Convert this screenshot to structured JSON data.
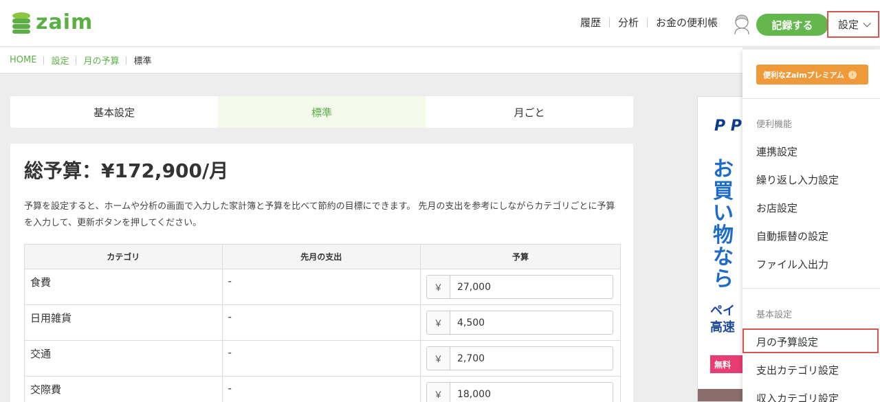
{
  "header": {
    "logo_text": "zaim",
    "nav": [
      "履歴",
      "分析",
      "お金の便利帳"
    ],
    "record_button": "記録する",
    "settings_button": "設定"
  },
  "breadcrumb": [
    "HOME",
    "設定",
    "月の予算",
    "標準"
  ],
  "tabs": [
    {
      "label": "基本設定",
      "active": false
    },
    {
      "label": "標準",
      "active": true
    },
    {
      "label": "月ごと",
      "active": false
    }
  ],
  "main": {
    "total": "総予算：¥172,900/月",
    "description": "予算を設定すると、ホームや分析の画面で入力した家計簿と予算を比べて節約の目標にできます。 先月の支出を参考にしながらカテゴリごとに予算を入力して、更新ボタンを押してください。",
    "table": {
      "headers": [
        "カテゴリ",
        "先月の支出",
        "予算"
      ],
      "currency_symbol": "￥",
      "rows": [
        {
          "category": "食費",
          "last_month": "-",
          "budget": "27,000"
        },
        {
          "category": "日用雑貨",
          "last_month": "-",
          "budget": "4,500"
        },
        {
          "category": "交通",
          "last_month": "-",
          "budget": "2,700"
        },
        {
          "category": "交際費",
          "last_month": "-",
          "budget": "18,000"
        }
      ]
    }
  },
  "ad": {
    "logo": "P P",
    "big_text": "お買い物なら",
    "mid_text": "ペイ 高速",
    "red_label": "無料"
  },
  "dropdown": {
    "premium": "便利なZaimプレミアム",
    "section1_header": "便利機能",
    "section1_items": [
      "連携設定",
      "繰り返し入力設定",
      "お店設定",
      "自動振替の設定",
      "ファイル入出力"
    ],
    "section2_header": "基本設定",
    "section2_items": [
      "月の予算設定",
      "支出カテゴリ設定",
      "収入カテゴリ設定"
    ]
  },
  "colors": {
    "brand_green": "#5ab045",
    "record_green": "#63b74d",
    "highlight_red": "#d9534f",
    "premium_orange": "#ef9a3a"
  }
}
